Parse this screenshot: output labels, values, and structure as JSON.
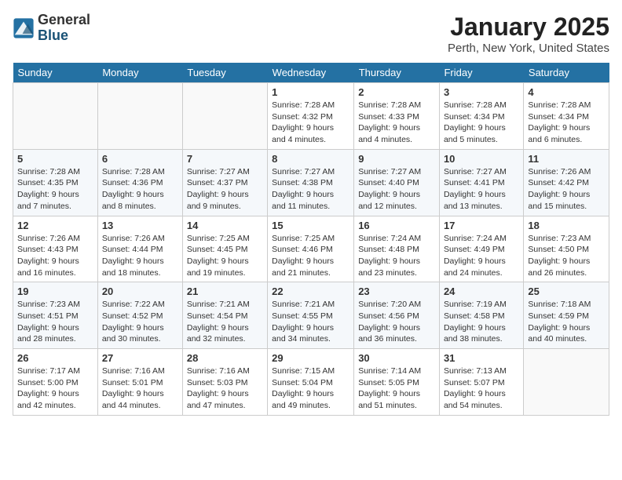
{
  "header": {
    "logo_general": "General",
    "logo_blue": "Blue",
    "month_title": "January 2025",
    "location": "Perth, New York, United States"
  },
  "weekdays": [
    "Sunday",
    "Monday",
    "Tuesday",
    "Wednesday",
    "Thursday",
    "Friday",
    "Saturday"
  ],
  "weeks": [
    [
      {
        "day": "",
        "info": ""
      },
      {
        "day": "",
        "info": ""
      },
      {
        "day": "",
        "info": ""
      },
      {
        "day": "1",
        "info": "Sunrise: 7:28 AM\nSunset: 4:32 PM\nDaylight: 9 hours\nand 4 minutes."
      },
      {
        "day": "2",
        "info": "Sunrise: 7:28 AM\nSunset: 4:33 PM\nDaylight: 9 hours\nand 4 minutes."
      },
      {
        "day": "3",
        "info": "Sunrise: 7:28 AM\nSunset: 4:34 PM\nDaylight: 9 hours\nand 5 minutes."
      },
      {
        "day": "4",
        "info": "Sunrise: 7:28 AM\nSunset: 4:34 PM\nDaylight: 9 hours\nand 6 minutes."
      }
    ],
    [
      {
        "day": "5",
        "info": "Sunrise: 7:28 AM\nSunset: 4:35 PM\nDaylight: 9 hours\nand 7 minutes."
      },
      {
        "day": "6",
        "info": "Sunrise: 7:28 AM\nSunset: 4:36 PM\nDaylight: 9 hours\nand 8 minutes."
      },
      {
        "day": "7",
        "info": "Sunrise: 7:27 AM\nSunset: 4:37 PM\nDaylight: 9 hours\nand 9 minutes."
      },
      {
        "day": "8",
        "info": "Sunrise: 7:27 AM\nSunset: 4:38 PM\nDaylight: 9 hours\nand 11 minutes."
      },
      {
        "day": "9",
        "info": "Sunrise: 7:27 AM\nSunset: 4:40 PM\nDaylight: 9 hours\nand 12 minutes."
      },
      {
        "day": "10",
        "info": "Sunrise: 7:27 AM\nSunset: 4:41 PM\nDaylight: 9 hours\nand 13 minutes."
      },
      {
        "day": "11",
        "info": "Sunrise: 7:26 AM\nSunset: 4:42 PM\nDaylight: 9 hours\nand 15 minutes."
      }
    ],
    [
      {
        "day": "12",
        "info": "Sunrise: 7:26 AM\nSunset: 4:43 PM\nDaylight: 9 hours\nand 16 minutes."
      },
      {
        "day": "13",
        "info": "Sunrise: 7:26 AM\nSunset: 4:44 PM\nDaylight: 9 hours\nand 18 minutes."
      },
      {
        "day": "14",
        "info": "Sunrise: 7:25 AM\nSunset: 4:45 PM\nDaylight: 9 hours\nand 19 minutes."
      },
      {
        "day": "15",
        "info": "Sunrise: 7:25 AM\nSunset: 4:46 PM\nDaylight: 9 hours\nand 21 minutes."
      },
      {
        "day": "16",
        "info": "Sunrise: 7:24 AM\nSunset: 4:48 PM\nDaylight: 9 hours\nand 23 minutes."
      },
      {
        "day": "17",
        "info": "Sunrise: 7:24 AM\nSunset: 4:49 PM\nDaylight: 9 hours\nand 24 minutes."
      },
      {
        "day": "18",
        "info": "Sunrise: 7:23 AM\nSunset: 4:50 PM\nDaylight: 9 hours\nand 26 minutes."
      }
    ],
    [
      {
        "day": "19",
        "info": "Sunrise: 7:23 AM\nSunset: 4:51 PM\nDaylight: 9 hours\nand 28 minutes."
      },
      {
        "day": "20",
        "info": "Sunrise: 7:22 AM\nSunset: 4:52 PM\nDaylight: 9 hours\nand 30 minutes."
      },
      {
        "day": "21",
        "info": "Sunrise: 7:21 AM\nSunset: 4:54 PM\nDaylight: 9 hours\nand 32 minutes."
      },
      {
        "day": "22",
        "info": "Sunrise: 7:21 AM\nSunset: 4:55 PM\nDaylight: 9 hours\nand 34 minutes."
      },
      {
        "day": "23",
        "info": "Sunrise: 7:20 AM\nSunset: 4:56 PM\nDaylight: 9 hours\nand 36 minutes."
      },
      {
        "day": "24",
        "info": "Sunrise: 7:19 AM\nSunset: 4:58 PM\nDaylight: 9 hours\nand 38 minutes."
      },
      {
        "day": "25",
        "info": "Sunrise: 7:18 AM\nSunset: 4:59 PM\nDaylight: 9 hours\nand 40 minutes."
      }
    ],
    [
      {
        "day": "26",
        "info": "Sunrise: 7:17 AM\nSunset: 5:00 PM\nDaylight: 9 hours\nand 42 minutes."
      },
      {
        "day": "27",
        "info": "Sunrise: 7:16 AM\nSunset: 5:01 PM\nDaylight: 9 hours\nand 44 minutes."
      },
      {
        "day": "28",
        "info": "Sunrise: 7:16 AM\nSunset: 5:03 PM\nDaylight: 9 hours\nand 47 minutes."
      },
      {
        "day": "29",
        "info": "Sunrise: 7:15 AM\nSunset: 5:04 PM\nDaylight: 9 hours\nand 49 minutes."
      },
      {
        "day": "30",
        "info": "Sunrise: 7:14 AM\nSunset: 5:05 PM\nDaylight: 9 hours\nand 51 minutes."
      },
      {
        "day": "31",
        "info": "Sunrise: 7:13 AM\nSunset: 5:07 PM\nDaylight: 9 hours\nand 54 minutes."
      },
      {
        "day": "",
        "info": ""
      }
    ]
  ]
}
